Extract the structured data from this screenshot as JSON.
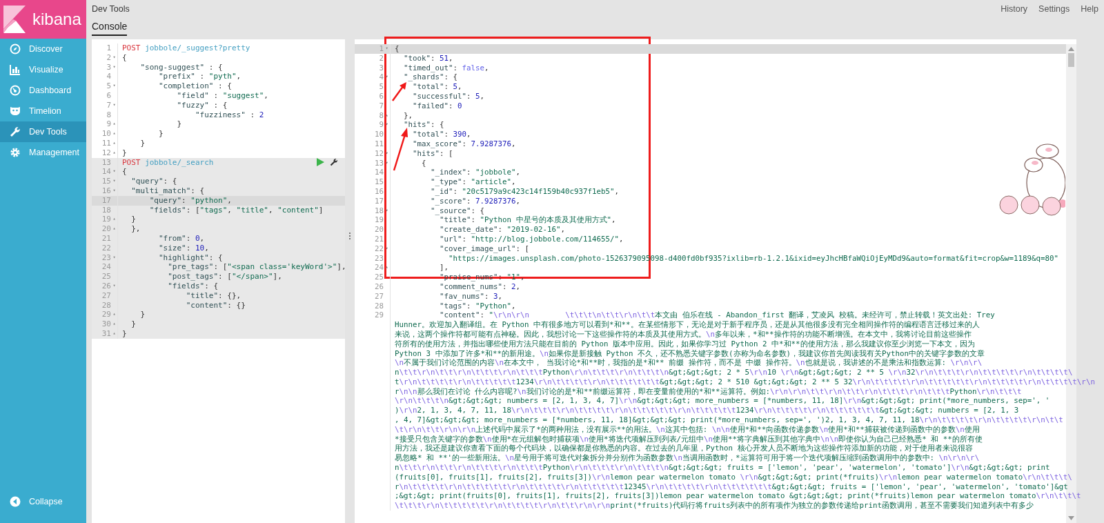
{
  "sidebar": {
    "logo": "kibana",
    "items": [
      {
        "label": "Discover",
        "selected": false
      },
      {
        "label": "Visualize",
        "selected": false
      },
      {
        "label": "Dashboard",
        "selected": false
      },
      {
        "label": "Timelion",
        "selected": false
      },
      {
        "label": "Dev Tools",
        "selected": true
      },
      {
        "label": "Management",
        "selected": false
      }
    ],
    "collapse": "Collapse"
  },
  "header": {
    "title": "Dev Tools",
    "links": [
      "History",
      "Settings",
      "Help"
    ],
    "tabs": [
      {
        "label": "Console",
        "selected": true
      }
    ]
  },
  "request_editor": {
    "requests": [
      {
        "number": "1",
        "method": "POST",
        "path": "jobbole/_suggest?pretty",
        "selected": false,
        "lines": [
          {
            "number": "2",
            "text": "{",
            "fold": "▾",
            "current": false
          },
          {
            "number": "3",
            "text": "    \"song-suggest\" : {",
            "fold": "▾",
            "current": false
          },
          {
            "number": "4",
            "text": "        \"prefix\" : \"pyth\",",
            "current": false
          },
          {
            "number": "5",
            "text": "        \"completion\" : {",
            "fold": "▾",
            "current": false
          },
          {
            "number": "6",
            "text": "            \"field\" : \"suggest\",",
            "current": false
          },
          {
            "number": "7",
            "text": "            \"fuzzy\" : {",
            "fold": "▾",
            "current": false
          },
          {
            "number": "8",
            "text": "                \"fuzziness\" : 2",
            "current": false
          },
          {
            "number": "9",
            "text": "            }",
            "fold": "▴",
            "current": false
          },
          {
            "number": "10",
            "text": "        }",
            "fold": "▴",
            "current": false
          },
          {
            "number": "11",
            "text": "    }",
            "fold": "▴",
            "current": false
          },
          {
            "number": "12",
            "text": "}",
            "fold": "▴",
            "current": false
          }
        ]
      },
      {
        "number": "13",
        "method": "POST",
        "path": "jobbole/_search",
        "selected": true,
        "lines": [
          {
            "number": "14",
            "text": "{",
            "fold": "▾",
            "current": false
          },
          {
            "number": "15",
            "text": "  \"query\": {",
            "fold": "▾",
            "current": false
          },
          {
            "number": "16",
            "text": "  \"multi_match\": {",
            "fold": "▾",
            "current": false
          },
          {
            "number": "17",
            "text": "      \"query\": \"python\",",
            "current": true
          },
          {
            "number": "18",
            "text": "      \"fields\": [\"tags\", \"title\", \"content\"]",
            "current": false
          },
          {
            "number": "19",
            "text": "  }",
            "fold": "▴",
            "current": false
          },
          {
            "number": "20",
            "text": "  },",
            "fold": "▴",
            "current": false
          },
          {
            "number": "21",
            "text": "        \"from\": 0,",
            "current": false
          },
          {
            "number": "22",
            "text": "        \"size\": 10,",
            "current": false
          },
          {
            "number": "23",
            "text": "        \"highlight\": {",
            "fold": "▾",
            "current": false
          },
          {
            "number": "24",
            "text": "          \"pre_tags\": [\"<span class='keyWord'>\"],",
            "current": false
          },
          {
            "number": "25",
            "text": "          \"post_tags\": [\"</span>\"],",
            "current": false
          },
          {
            "number": "26",
            "text": "          \"fields\": {",
            "fold": "▾",
            "current": false
          },
          {
            "number": "27",
            "text": "              \"title\": {},",
            "current": false
          },
          {
            "number": "28",
            "text": "              \"content\": {}",
            "current": false
          },
          {
            "number": "29",
            "text": "    }",
            "fold": "▴",
            "current": false
          },
          {
            "number": "30",
            "text": "  }",
            "fold": "▴",
            "current": false
          },
          {
            "number": "31",
            "text": "}",
            "fold": "▴",
            "current": false
          }
        ]
      }
    ]
  },
  "response_editor": {
    "lines": [
      {
        "number": "1",
        "text": "{",
        "fold": "▾",
        "current": true
      },
      {
        "number": "2",
        "text": "  \"took\": 51,",
        "current": false
      },
      {
        "number": "3",
        "text": "  \"timed_out\": false,",
        "current": false
      },
      {
        "number": "4",
        "text": "  \"_shards\": {",
        "fold": "▾",
        "current": false
      },
      {
        "number": "5",
        "text": "    \"total\": 5,",
        "current": false
      },
      {
        "number": "6",
        "text": "    \"successful\": 5,",
        "current": false
      },
      {
        "number": "7",
        "text": "    \"failed\": 0",
        "current": false
      },
      {
        "number": "8",
        "text": "  },",
        "fold": "▴",
        "current": false
      },
      {
        "number": "9",
        "text": "  \"hits\": {",
        "fold": "▾",
        "current": false
      },
      {
        "number": "10",
        "text": "    \"total\": 390,",
        "current": false
      },
      {
        "number": "11",
        "text": "    \"max_score\": 7.9287376,",
        "current": false
      },
      {
        "number": "12",
        "text": "    \"hits\": [",
        "fold": "▾",
        "current": false
      },
      {
        "number": "13",
        "text": "      {",
        "fold": "▾",
        "current": false
      },
      {
        "number": "14",
        "text": "        \"_index\": \"jobbole\",",
        "current": false
      },
      {
        "number": "15",
        "text": "        \"_type\": \"article\",",
        "current": false
      },
      {
        "number": "16",
        "text": "        \"_id\": \"20c5179a9c423c14f159b40c937f1eb5\",",
        "current": false
      },
      {
        "number": "17",
        "text": "        \"_score\": 7.9287376,",
        "current": false
      },
      {
        "number": "18",
        "text": "        \"_source\": {",
        "fold": "▾",
        "current": false
      },
      {
        "number": "19",
        "text": "          \"title\": \"Python 中星号的本质及其使用方式\",",
        "current": false
      },
      {
        "number": "20",
        "text": "          \"create_date\": \"2019-02-16\",",
        "current": false
      },
      {
        "number": "21",
        "text": "          \"url\": \"http://blog.jobbole.com/114655/\",",
        "current": false
      },
      {
        "number": "22",
        "text": "          \"cover_image_url\": [",
        "fold": "▾",
        "current": false
      },
      {
        "number": "23",
        "text": "            \"https://images.unsplash.com/photo-1526379095098-d400fd0bf935?ixlib=rb-1.2.1&ixid=eyJhcHBfaWQiOjEyMDd9&auto=format&fit=crop&w=1189&q=80\"",
        "current": false
      },
      {
        "number": "24",
        "text": "          ],",
        "fold": "▴",
        "current": false
      },
      {
        "number": "25",
        "text": "          \"praise_nums\": \"1\",",
        "current": false
      },
      {
        "number": "26",
        "text": "          \"comment_nums\": 2,",
        "current": false
      },
      {
        "number": "27",
        "text": "          \"fav_nums\": 3,",
        "current": false
      },
      {
        "number": "28",
        "text": "          \"tags\": \"Python\",",
        "current": false
      },
      {
        "number": "29",
        "text": "          \"content\": \"\\r\\n\\r\\n        \\t\\t\\t\\n\\t\\t\\r\\n\\t\\t本文由 伯乐在线 - Abandon_first 翻译，艾凌风 校稿。未经许可，禁止转载！英文出处: Trey",
        "current": false
      },
      {
        "text": "Hunner。欢迎加入翻译组。在 Python 中有很多地方可以看到*和**。在某些情形下，无论是对于新手程序员，还是从其他很多没有完全相同操作符的编程语言迁移过来的人",
        "current": false
      },
      {
        "text": "来说，这两个操作符都可能有点神秘。因此，我想讨论一下这些操作符的本质及其使用方式。\\n多年以来，*和**操作符的功能不断增强。在本文中，我将讨论目前这些操作",
        "current": false
      },
      {
        "text": "符所有的使用方法，并指出哪些使用方法只能在目前的 Python 版本中应用。因此，如果你学习过 Python 2 中*和**的使用方法，那么我建议你至少浏览一下本文，因为",
        "current": false
      },
      {
        "text": "Python 3 中添加了许多*和**的新用途。\\n如果你是新接触 Python 不久，还不熟悉关键字参数(亦称为命名参数)，我建议你首先阅读我有关Python中的关键字参数的文章",
        "current": false
      },
      {
        "text": "\\n不属于我们讨论范围的内容\\n在本文中， 当我讨论*和**时，我指的是*和** 前缀 操作符，而不是 中缀 操作符。\\n也就是说，我讲述的不是乘法和指数运算: \\r\\n\\r\\",
        "current": false
      },
      {
        "text": "n\\t\\t\\r\\n\\t\\t\\r\\n\\t\\t\\t\\r\\n\\t\\t\\tPython\\r\\n\\t\\t\\t\\r\\n\\t\\t\\t\\n&gt;&gt;&gt; 2 * 5\\r\\n10 \\r\\n&gt;&gt;&gt; 2 ** 5 \\r\\n32\\r\\n\\t\\t\\t\\r\\n\\t\\t\\t\\t\\r\\n\\t\\t\\t\\t\\",
        "current": false
      },
      {
        "text": "t\\r\\n\\t\\t\\t\\t\\r\\n\\t\\t\\t\\t\\t1234\\r\\n\\t\\t\\t\\t\\r\\n\\t\\t\\t\\t\\t\\t&gt;&gt;&gt; 2 * 510 &gt;&gt;&gt; 2 ** 5 32\\r\\n\\t\\t\\t\\t\\r\\n\\t\\t\\t\\t\\t\\r\\n\\t\\t\\t\\t\\r\\n\\t\\t\\t\\t\\r\\n",
        "current": false
      },
      {
        "text": "r\\n\\n那么我们在讨论 什么内容呢?\\n我们讨论的是*和**前缀运算符，即在变量前使用的*和**运算符。例如:\\r\\n\\r\\n\\t\\t\\r\\n\\t\\t\\r\\n\\t\\t\\t\\r\\n\\t\\t\\tPython\\r\\n\\t\\t\\t",
        "current": false
      },
      {
        "text": "\\r\\n\\t\\t\\t\\n&gt;&gt;&gt; numbers = [2, 1, 3, 4, 7]\\r\\n&gt;&gt;&gt; more_numbers = [*numbers, 11, 18]\\r\\n&gt;&gt;&gt; print(*more_numbers, sep=', '",
        "current": false
      },
      {
        "text": ")\\r\\n2, 1, 3, 4, 7, 11, 18\\r\\n\\t\\t\\t\\r\\n\\t\\t\\t\\t\\r\\n\\t\\t\\t\\t\\t\\r\\n\\t\\t\\t\\t\\t1234\\r\\n\\t\\t\\t\\t\\r\\n\\t\\t\\t\\t\\t\\t&gt;&gt;&gt; numbers = [2, 1, 3",
        "current": false
      },
      {
        "text": ", 4, 7]&gt;&gt;&gt; more_numbers = [*numbers, 11, 18]&gt;&gt;&gt; print(*more_numbers, sep=', ')2, 1, 3, 4, 7, 11, 18\\r\\n\\t\\t\\t\\t\\r\\n\\t\\t\\t\\t\\r\\n\\t\\t",
        "current": false
      },
      {
        "text": "\\t\\r\\n\\t\\t\\r\\n\\r\\n上述代码中展示了*的两种用法，没有展示**的用法。\\n这其中包括: \\n\\n使用*和**向函数传递参数\\n使用*和**捕获被传递到函数中的参数\\n使用",
        "current": false
      },
      {
        "text": "*接受只包含关键字的参数\\n使用*在元组解包时捕获项\\n使用*将迭代项解压到列表/元组中\\n使用**将字典解压到其他字典中\\n\\n即使你认为自己已经熟悉* 和 **的所有使",
        "current": false
      },
      {
        "text": "用方法，我还是建议你查看下面的每个代码块，以确保都是你熟悉的内容。在过去的几年里，Python 核心开发人员不断地为这些操作符添加新的功能，对于使用者来说很容",
        "current": false
      },
      {
        "text": "易忽略* 和 **'的一些新用法。\\n星号用于将可迭代对象拆分并分别作为函数参数\\n当调用函数时，*运算符可用于将一个迭代项解压缩到函数调用中的参数中: \\n\\r\\n\\r\\",
        "current": false
      },
      {
        "text": "n\\t\\t\\r\\n\\t\\t\\r\\n\\t\\t\\t\\r\\n\\t\\t\\tPython\\r\\n\\t\\t\\t\\r\\n\\t\\t\\t\\n&gt;&gt;&gt; fruits = ['lemon', 'pear', 'watermelon', 'tomato']\\r\\n&gt;&gt;&gt; print",
        "current": false
      },
      {
        "text": "(fruits[0], fruits[1], fruits[2], fruits[3])\\r\\nlemon pear watermelon tomato \\r\\n&gt;&gt;&gt; print(*fruits)\\r\\nlemon pear watermelon tomato\\r\\n\\t\\t\\t\\",
        "current": false
      },
      {
        "text": "r\\n\\t\\t\\t\\t\\r\\n\\t\\t\\t\\t\\t\\r\\n\\t\\t\\t\\t\\r\\n\\t\\t\\t\\t\\t12345\\r\\n\\t\\t\\t\\t\\r\\n\\t\\t\\t\\t\\t\\t&gt;&gt;&gt; fruits = ['lemon', 'pear', 'watermelon', 'tomato']&gt",
        "current": false
      },
      {
        "text": ";&gt;&gt; print(fruits[0], fruits[1], fruits[2], fruits[3])lemon pear watermelon tomato &gt;&gt;&gt; print(*fruits)lemon pear watermelon tomato\\r\\n\\t\\t\\t",
        "current": false
      },
      {
        "text": "\\t\\t\\t\\r\\n\\t\\t\\t\\t\\t\\r\\n\\t\\t\\t\\t\\r\\n\\t\\t\\r\\n\\r\\nprint(*fruits)代码行将fruits列表中的所有项作为独立的参数传递给print函数调用，甚至不需要我们知道列表中有多少",
        "current": false
      }
    ]
  }
}
